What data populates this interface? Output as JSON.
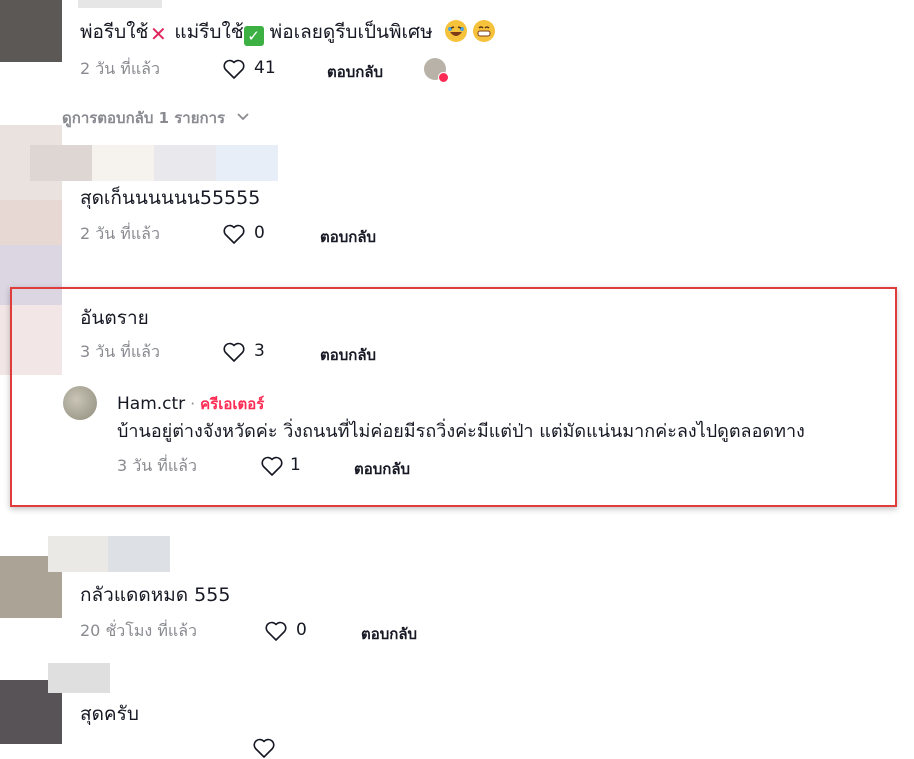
{
  "comments": [
    {
      "text_part1": "พ่อรีบใช้",
      "text_part2": " แม่รีบใช้",
      "text_part3": " พ่อเลยดูรีบเป็นพิเศษ",
      "time": "2 วัน ที่แล้ว",
      "likes": "41",
      "reply_label": "ตอบกลับ",
      "view_replies": "ดูการตอบกลับ 1 รายการ"
    },
    {
      "text": "สุดเก็นนนนนน55555",
      "time": "2 วัน ที่แล้ว",
      "likes": "0",
      "reply_label": "ตอบกลับ"
    },
    {
      "text": "อันตราย",
      "time": "3 วัน ที่แล้ว",
      "likes": "3",
      "reply_label": "ตอบกลับ",
      "reply": {
        "username": "Ham.ctr",
        "separator": "·",
        "badge": "ครีเอเตอร์",
        "text": "บ้านอยู่ต่างจังหวัดค่ะ วิ่งถนนที่ไม่ค่อยมีรถวิ่งค่ะมีแต่ป่า แต่มัดแน่นมากค่ะลงไปดูตลอดทาง",
        "time": "3 วัน ที่แล้ว",
        "likes": "1",
        "reply_label": "ตอบกลับ"
      }
    },
    {
      "text": "กลัวแดดหมด 555",
      "time": "20 ชั่วโมง ที่แล้ว",
      "likes": "0",
      "reply_label": "ตอบกลับ"
    },
    {
      "text": "สุดครับ",
      "time": "",
      "likes": "",
      "reply_label": ""
    }
  ],
  "colors": {
    "creator_badge": "#fe2c55",
    "highlight_border": "#e03c3c",
    "meta_text": "#8a8b91"
  },
  "icons": [
    "heart-icon",
    "chevron-down-icon",
    "cross-mark-icon",
    "check-mark-icon",
    "laughing-emoji-icon",
    "grinning-emoji-icon",
    "liked-by-creator-icon"
  ]
}
